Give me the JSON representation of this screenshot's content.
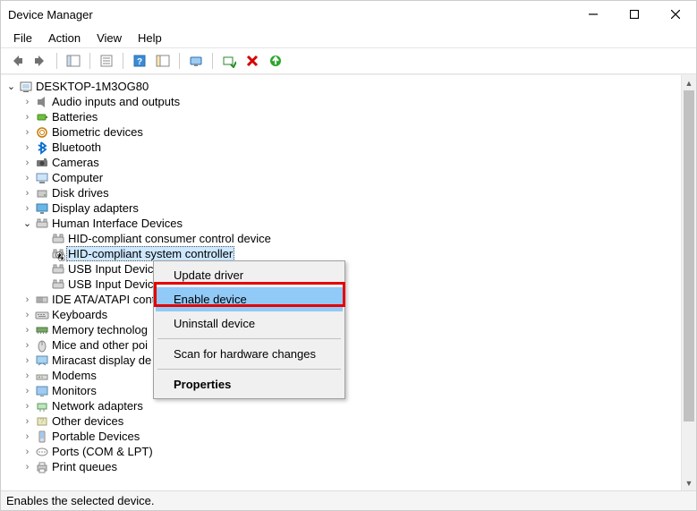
{
  "window": {
    "title": "Device Manager"
  },
  "menu": {
    "file": "File",
    "action": "Action",
    "view": "View",
    "help": "Help"
  },
  "root": {
    "name": "DESKTOP-1M3OG80"
  },
  "categories": [
    {
      "label": "Audio inputs and outputs",
      "icon": "speaker",
      "exp": "right"
    },
    {
      "label": "Batteries",
      "icon": "battery",
      "exp": "right"
    },
    {
      "label": "Biometric devices",
      "icon": "biometric",
      "exp": "right"
    },
    {
      "label": "Bluetooth",
      "icon": "bluetooth",
      "exp": "right"
    },
    {
      "label": "Cameras",
      "icon": "camera",
      "exp": "right"
    },
    {
      "label": "Computer",
      "icon": "computer",
      "exp": "right"
    },
    {
      "label": "Disk drives",
      "icon": "disk",
      "exp": "right"
    },
    {
      "label": "Display adapters",
      "icon": "display",
      "exp": "right"
    },
    {
      "label": "Human Interface Devices",
      "icon": "hid",
      "exp": "down",
      "children": [
        {
          "label": "HID-compliant consumer control device",
          "icon": "hid"
        },
        {
          "label": "HID-compliant system controller",
          "icon": "hid-disabled",
          "selected": true
        },
        {
          "label": "USB Input Devic",
          "icon": "hid"
        },
        {
          "label": "USB Input Devic",
          "icon": "hid"
        }
      ]
    },
    {
      "label": "IDE ATA/ATAPI cont",
      "icon": "ide",
      "exp": "right"
    },
    {
      "label": "Keyboards",
      "icon": "keyboard",
      "exp": "right"
    },
    {
      "label": "Memory technolog",
      "icon": "memory",
      "exp": "right"
    },
    {
      "label": "Mice and other poi",
      "icon": "mouse",
      "exp": "right"
    },
    {
      "label": "Miracast display de",
      "icon": "miracast",
      "exp": "right"
    },
    {
      "label": "Modems",
      "icon": "modem",
      "exp": "right"
    },
    {
      "label": "Monitors",
      "icon": "monitor",
      "exp": "right"
    },
    {
      "label": "Network adapters",
      "icon": "network",
      "exp": "right"
    },
    {
      "label": "Other devices",
      "icon": "other",
      "exp": "right"
    },
    {
      "label": "Portable Devices",
      "icon": "portable",
      "exp": "right"
    },
    {
      "label": "Ports (COM & LPT)",
      "icon": "port",
      "exp": "right"
    },
    {
      "label": "Print queues",
      "icon": "print",
      "exp": "right"
    }
  ],
  "context_menu": {
    "update": "Update driver",
    "enable": "Enable device",
    "uninstall": "Uninstall device",
    "scan": "Scan for hardware changes",
    "properties": "Properties"
  },
  "status": {
    "text": "Enables the selected device."
  }
}
